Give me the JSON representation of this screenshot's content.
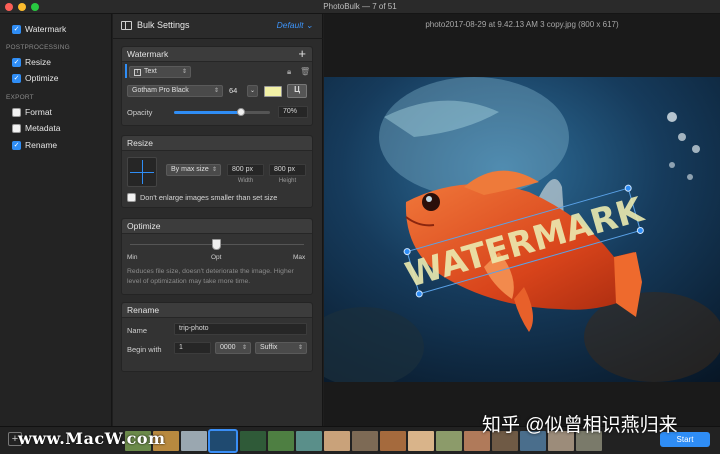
{
  "window": {
    "title": "PhotoBulk — 7 of 51"
  },
  "sidebar": {
    "items": [
      {
        "label": "Watermark",
        "checked": true
      },
      {
        "label": "Resize",
        "checked": true
      },
      {
        "label": "Optimize",
        "checked": true
      },
      {
        "label": "Format",
        "checked": false
      },
      {
        "label": "Metadata",
        "checked": false
      },
      {
        "label": "Rename",
        "checked": true
      }
    ],
    "sections": {
      "postprocessing": "POSTPROCESSING",
      "export": "EXPORT"
    }
  },
  "panel": {
    "title": "Bulk Settings",
    "preset": "Default",
    "watermark": {
      "title": "Watermark",
      "type": "Text",
      "font": "Gotham Pro Black",
      "size": "64",
      "color": "#f2f1a6",
      "opacity_label": "Opacity",
      "opacity_value": "70%",
      "opacity_fraction": 0.7
    },
    "resize": {
      "title": "Resize",
      "mode": "By max size",
      "width": "800 px",
      "height": "800 px",
      "width_label": "Width",
      "height_label": "Height",
      "checkbox_label": "Don't enlarge images smaller than set size"
    },
    "optimize": {
      "title": "Optimize",
      "min": "Min",
      "opt": "Opt",
      "max": "Max",
      "level_fraction": 0.5,
      "note": "Reduces file size, doesn't deteriorate the image. Higher level of optimization may take more time."
    },
    "rename": {
      "title": "Rename",
      "name_label": "Name",
      "name_value": "trip-photo",
      "begin_label": "Begin with",
      "begin_value": "1",
      "digits": "0000",
      "position": "Suffix"
    }
  },
  "viewer": {
    "file_title": "photo2017-08-29 at 9.42.13 AM 3 copy.jpg (800 x 617)",
    "watermark_text": "WATERMARK"
  },
  "filmstrip": {
    "start_label": "Start",
    "add_label": "+"
  },
  "overlays": {
    "left_mark": "www.MacW.com",
    "right_mark": "知乎 @似曾相识燕归来"
  }
}
